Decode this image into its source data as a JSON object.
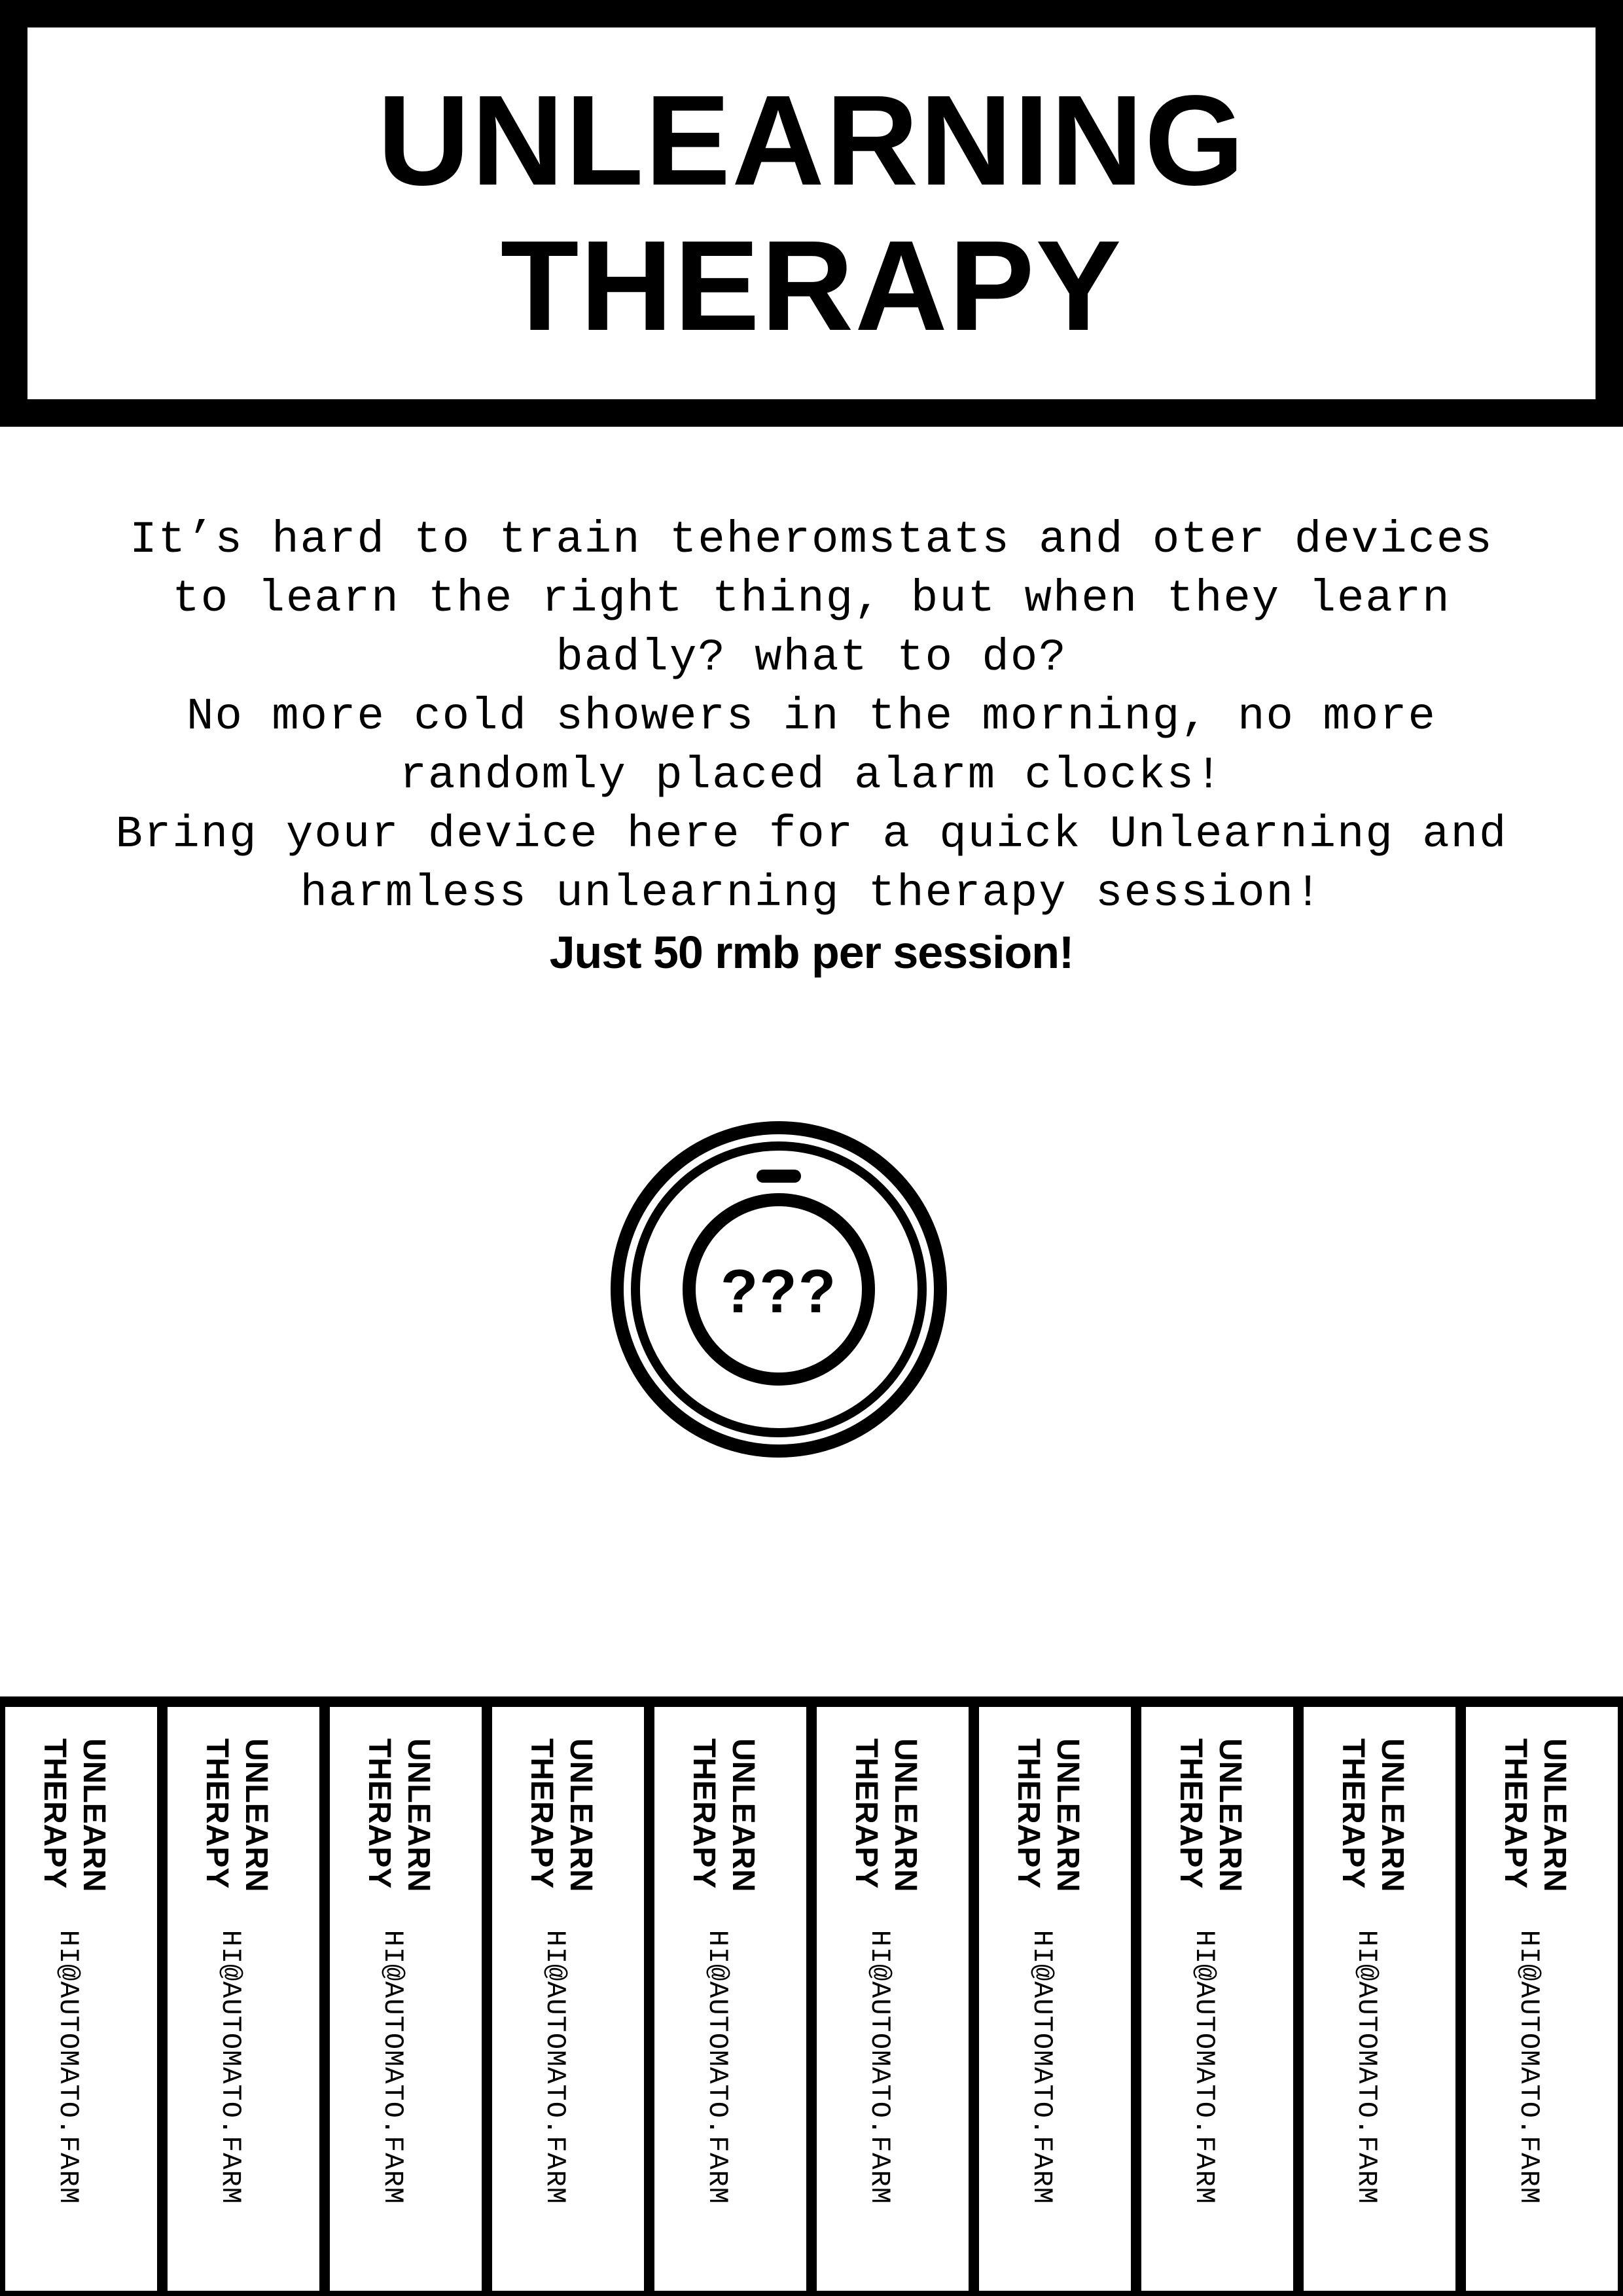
{
  "header": {
    "title_line_1": "UNLEARNING",
    "title_line_2": "THERAPY"
  },
  "body": {
    "lines": [
      "It’s hard to train teheromstats and oter devices",
      "to learn the right thing, but when they learn",
      "badly? what to do?",
      "No more cold showers in the morning, no more",
      "randomly placed alarm clocks!",
      "Bring your device here for a quick Unlearning and",
      "harmless unlearning therapy session!"
    ],
    "price": "Just 50 rmb per session!"
  },
  "icon": {
    "name": "thermostat-icon",
    "label": "???"
  },
  "tabs": {
    "items": [
      {
        "title_1": "UNLEARN",
        "title_2": "THERAPY",
        "contact": "HI@AUTOMATO.FARM"
      },
      {
        "title_1": "UNLEARN",
        "title_2": "THERAPY",
        "contact": "HI@AUTOMATO.FARM"
      },
      {
        "title_1": "UNLEARN",
        "title_2": "THERAPY",
        "contact": "HI@AUTOMATO.FARM"
      },
      {
        "title_1": "UNLEARN",
        "title_2": "THERAPY",
        "contact": "HI@AUTOMATO.FARM"
      },
      {
        "title_1": "UNLEARN",
        "title_2": "THERAPY",
        "contact": "HI@AUTOMATO.FARM"
      },
      {
        "title_1": "UNLEARN",
        "title_2": "THERAPY",
        "contact": "HI@AUTOMATO.FARM"
      },
      {
        "title_1": "UNLEARN",
        "title_2": "THERAPY",
        "contact": "HI@AUTOMATO.FARM"
      },
      {
        "title_1": "UNLEARN",
        "title_2": "THERAPY",
        "contact": "HI@AUTOMATO.FARM"
      },
      {
        "title_1": "UNLEARN",
        "title_2": "THERAPY",
        "contact": "HI@AUTOMATO.FARM"
      },
      {
        "title_1": "UNLEARN",
        "title_2": "THERAPY",
        "contact": "HI@AUTOMATO.FARM"
      }
    ]
  },
  "colors": {
    "ink": "#000000",
    "paper": "#ffffff"
  }
}
